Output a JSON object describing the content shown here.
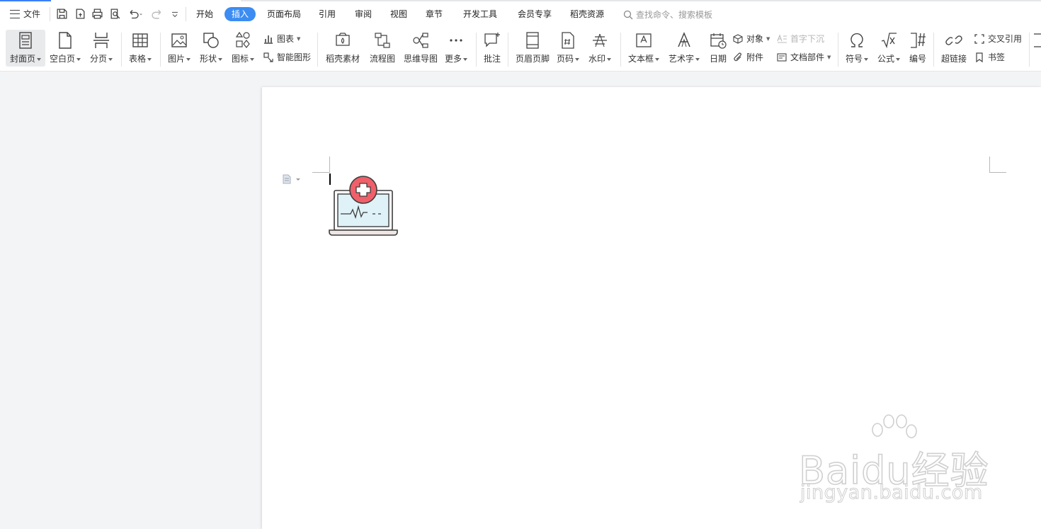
{
  "menu": {
    "file_label": "文件"
  },
  "tabs": [
    "开始",
    "插入",
    "页面布局",
    "引用",
    "审阅",
    "视图",
    "章节",
    "开发工具",
    "会员专享",
    "稻壳资源"
  ],
  "active_tab": "插入",
  "search": {
    "placeholder": "查找命令、搜索模板"
  },
  "ribbon": {
    "cover_page": "封面页",
    "blank_page": "空白页",
    "page_break": "分页",
    "table": "表格",
    "picture": "图片",
    "shape": "形状",
    "icons": "图标",
    "chart": "图表",
    "smart_art": "智能图形",
    "docer_material": "稻壳素材",
    "flowchart": "流程图",
    "mind_map": "思维导图",
    "more": "更多",
    "comment": "批注",
    "header_footer": "页眉页脚",
    "page_number": "页码",
    "watermark": "水印",
    "text_box": "文本框",
    "word_art": "艺术字",
    "date": "日期",
    "object": "对象",
    "attachment": "附件",
    "drop_cap": "首字下沉",
    "doc_parts": "文档部件",
    "symbol": "符号",
    "formula": "公式",
    "numbering": "编号",
    "hyperlink": "超链接",
    "cross_reference": "交叉引用",
    "bookmark": "书签"
  },
  "watermark": {
    "brand": "Baidu经验",
    "url": "jingyan.baidu.com"
  },
  "colors": {
    "accent": "#3c8cf2",
    "medical_red": "#f0606a",
    "screen_blue": "#dff2f8"
  }
}
